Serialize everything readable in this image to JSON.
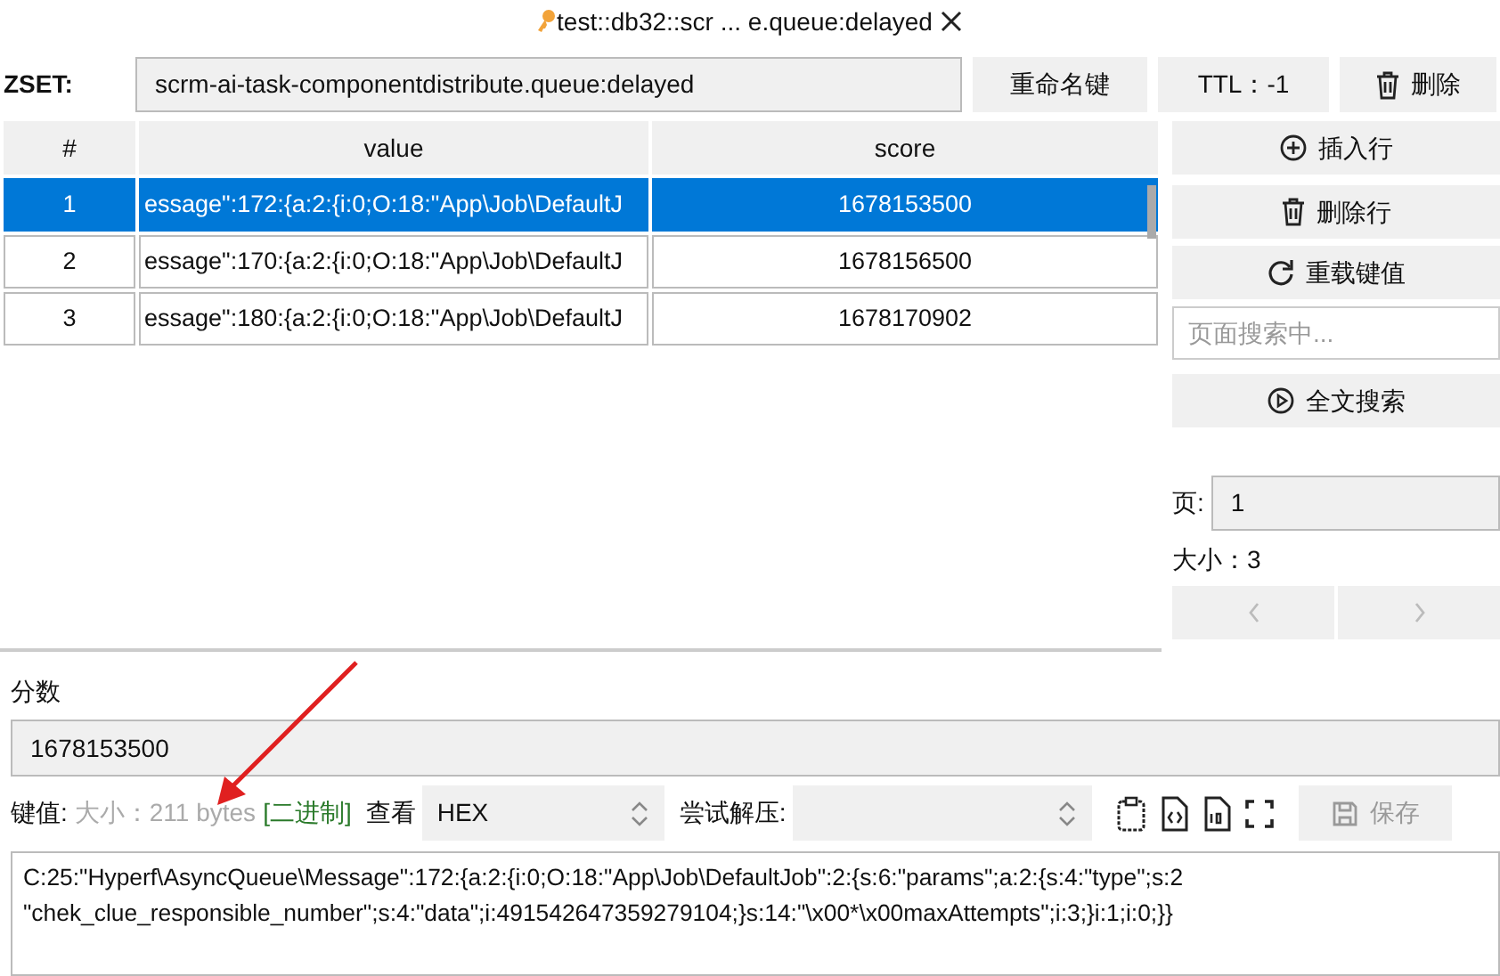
{
  "window": {
    "title": "test::db32::scr ... e.queue:delayed"
  },
  "key": {
    "type_label": "ZSET:",
    "name": "scrm-ai-task-componentdistribute.queue:delayed",
    "rename_button": "重命名键",
    "ttl": "TTL：-1",
    "delete_button": "删除"
  },
  "table": {
    "columns": [
      "#",
      "value",
      "score"
    ],
    "rows": [
      {
        "index": "1",
        "value": "essage\":172:{a:2:{i:0;O:18:\"App\\Job\\DefaultJ",
        "score": "1678153500",
        "selected": true
      },
      {
        "index": "2",
        "value": "essage\":170:{a:2:{i:0;O:18:\"App\\Job\\DefaultJ",
        "score": "1678156500",
        "selected": false
      },
      {
        "index": "3",
        "value": "essage\":180:{a:2:{i:0;O:18:\"App\\Job\\DefaultJ",
        "score": "1678170902",
        "selected": false
      }
    ]
  },
  "side": {
    "insert_row": "插入行",
    "delete_row": "删除行",
    "reload": "重载键值",
    "search_placeholder": "页面搜索中...",
    "full_search": "全文搜索",
    "page_label": "页:",
    "page": "1",
    "size": "大小：3"
  },
  "detail": {
    "score_label": "分数",
    "score": "1678153500",
    "value_label": "键值:",
    "size": "大小：211 bytes",
    "binary": "[二进制]",
    "view_label": "查看",
    "view_mode": "HEX",
    "decompress_label": "尝试解压:",
    "save_button": "保存",
    "save_disabled": true,
    "value_lines": [
      "C:25:\"Hyperf\\AsyncQueue\\Message\":172:{a:2:{i:0;O:18:\"App\\Job\\DefaultJob\":2:{s:6:\"params\";a:2:{s:4:\"type\";s:2",
      "\"chek_clue_responsible_number\";s:4:\"data\";i:491542647359279104;}s:14:\"\\x00*\\x00maxAttempts\";i:3;}i:1;i:0;}}"
    ]
  }
}
